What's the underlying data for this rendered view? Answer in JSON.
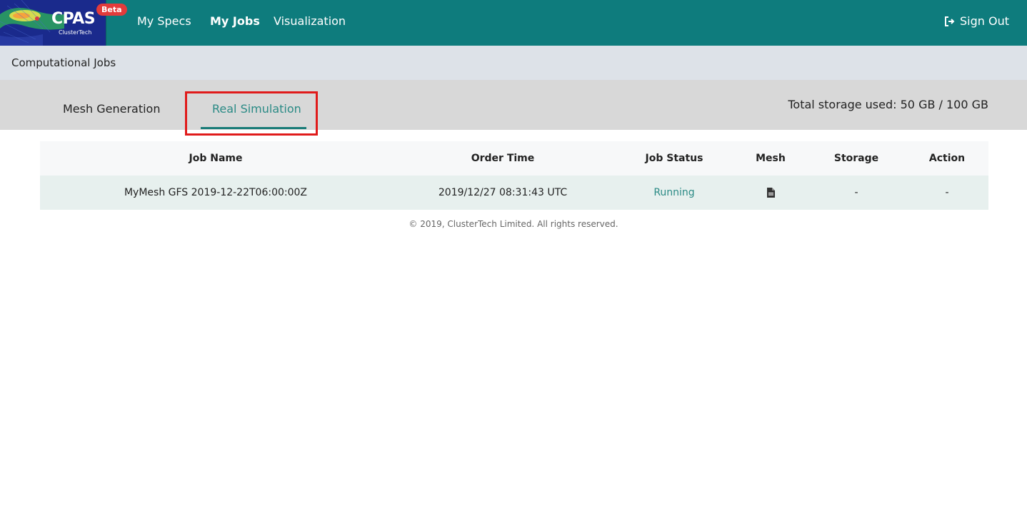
{
  "app": {
    "logo_title": "CPAS",
    "logo_subtitle": "ClusterTech",
    "beta_badge": "Beta"
  },
  "nav": {
    "items": [
      {
        "label": "My Specs"
      },
      {
        "label": "My Jobs",
        "active": true
      },
      {
        "label": "Visualization"
      }
    ],
    "sign_out": "Sign Out"
  },
  "breadcrumb": {
    "title": "Computational Jobs"
  },
  "tabs": {
    "items": [
      {
        "label": "Mesh Generation"
      },
      {
        "label": "Real Simulation",
        "active": true
      }
    ],
    "storage_text": "Total storage used: 50 GB / 100 GB"
  },
  "table": {
    "columns": [
      "Job Name",
      "Order Time",
      "Job Status",
      "Mesh",
      "Storage",
      "Action"
    ],
    "rows": [
      {
        "job_name": "MyMesh GFS 2019-12-22T06:00:00Z",
        "order_time": "2019/12/27 08:31:43 UTC",
        "job_status": "Running",
        "mesh_icon": "file-icon",
        "storage": "-",
        "action": "-"
      }
    ]
  },
  "footer": {
    "text": "© 2019, ClusterTech Limited. All rights reserved."
  },
  "colors": {
    "navbar": "#0e7c7d",
    "accent": "#2a8a85",
    "beta": "#e23b3b",
    "highlight": "#e01b1b"
  }
}
